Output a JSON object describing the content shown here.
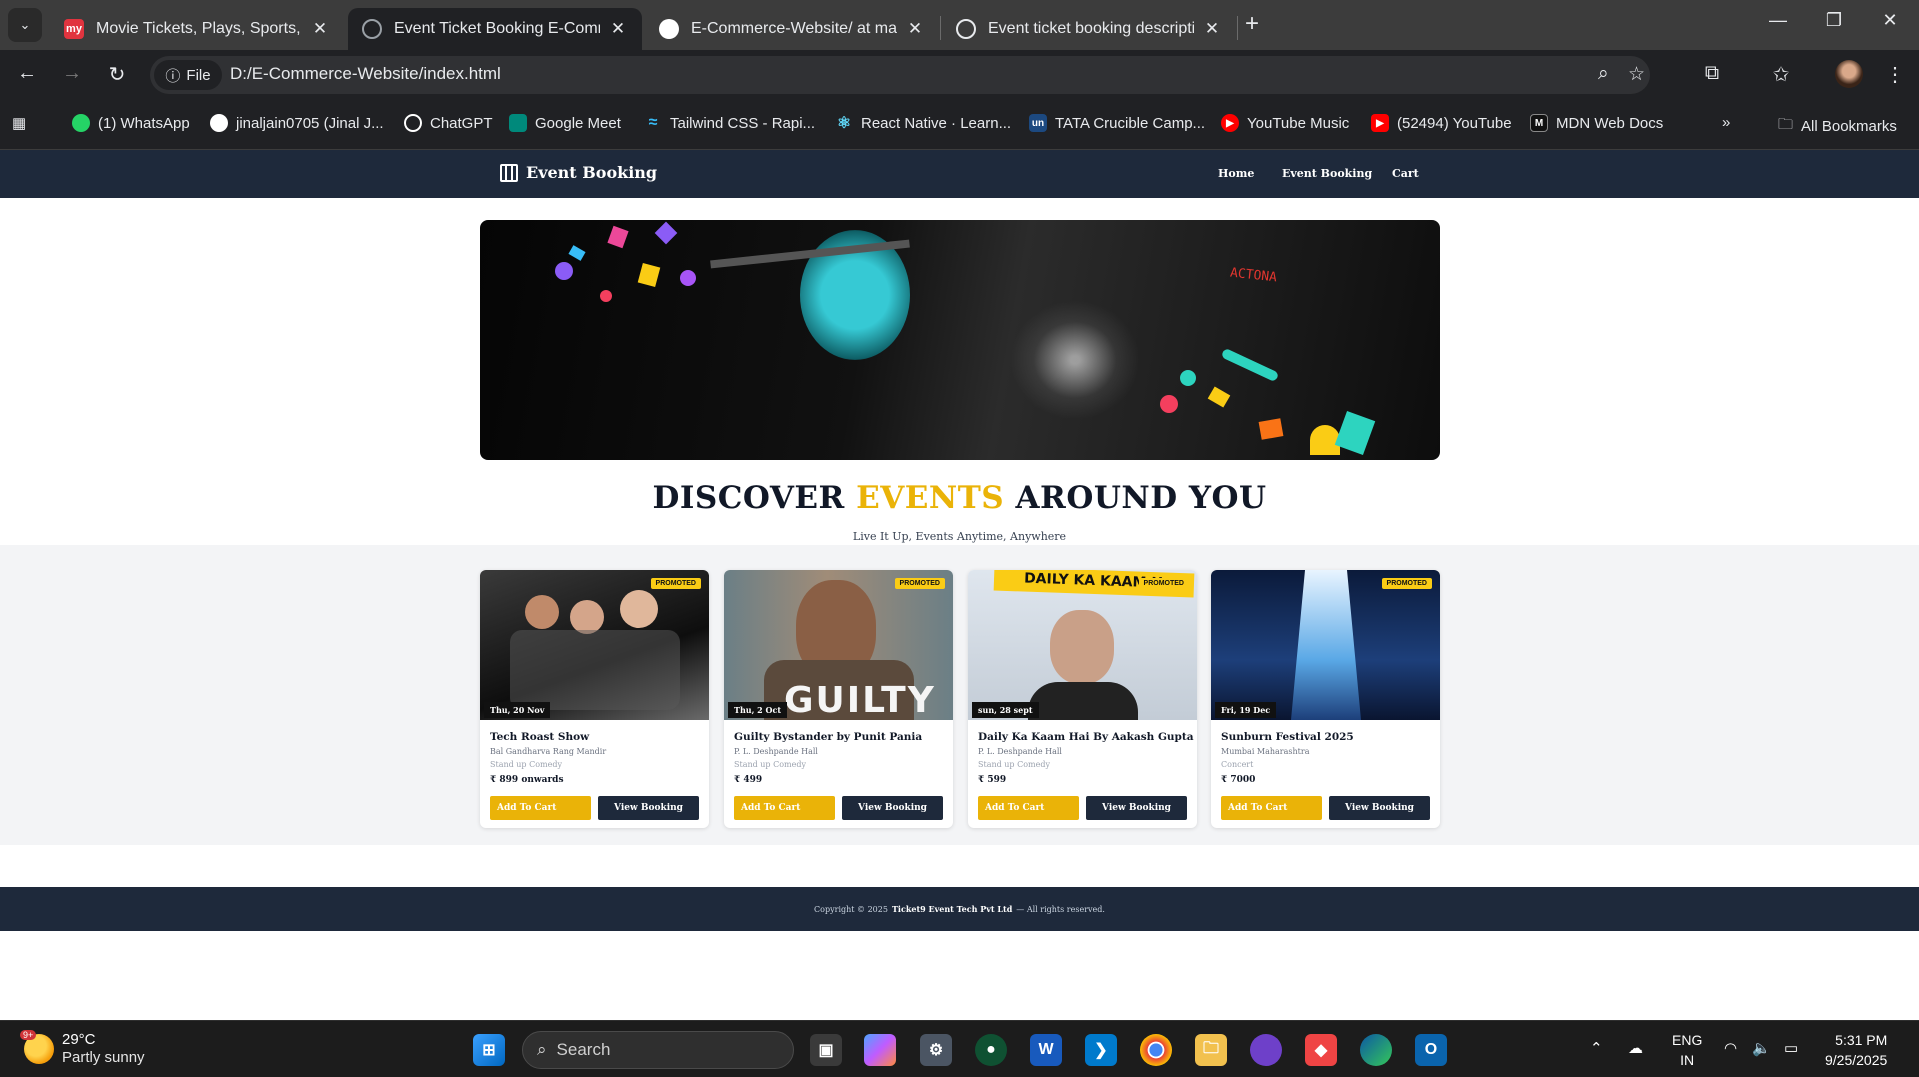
{
  "browser": {
    "tabs": [
      {
        "title": "Movie Tickets, Plays, Sports, Eve",
        "favicon": "my",
        "fav_color": "#e1343f",
        "active": false
      },
      {
        "title": "Event Ticket Booking E-Comme",
        "favicon": "globe",
        "fav_color": "#5f6368",
        "active": true
      },
      {
        "title": "E-Commerce-Website/ at main",
        "favicon": "github",
        "fav_color": "#ffffff",
        "active": false
      },
      {
        "title": "Event ticket booking descriptio",
        "favicon": "openai",
        "fav_color": "#ffffff",
        "active": false
      }
    ],
    "address": {
      "chip": "File",
      "url": "D:/E-Commerce-Website/index.html"
    },
    "bookmarks": [
      {
        "label": "(1) WhatsApp",
        "icon": "whatsapp-icon",
        "color": "#25d366"
      },
      {
        "label": "jinaljain0705 (Jinal J...",
        "icon": "github-icon",
        "color": "#ffffff"
      },
      {
        "label": "ChatGPT",
        "icon": "openai-icon",
        "color": "#ffffff"
      },
      {
        "label": "Google Meet",
        "icon": "meet-icon",
        "color": "#00897b"
      },
      {
        "label": "Tailwind CSS - Rapi...",
        "icon": "tailwind-icon",
        "color": "#38bdf8"
      },
      {
        "label": "React Native · Learn...",
        "icon": "react-icon",
        "color": "#61dafb"
      },
      {
        "label": "TATA Crucible Camp...",
        "icon": "unstop-icon",
        "color": "#1c4980"
      },
      {
        "label": "YouTube Music",
        "icon": "youtube-music-icon",
        "color": "#ff0000"
      },
      {
        "label": "(52494) YouTube",
        "icon": "youtube-icon",
        "color": "#ff0000"
      },
      {
        "label": "MDN Web Docs",
        "icon": "mdn-icon",
        "color": "#111111"
      }
    ],
    "all_bookmarks": "All Bookmarks"
  },
  "site": {
    "brand": "Event Booking",
    "nav": [
      "Home",
      "Event Booking",
      "Cart"
    ],
    "hero_sign": "ACTONA",
    "heading": {
      "part1": "DISCOVER",
      "highlight": "EVENTS",
      "part2": "AROUND  YOU"
    },
    "tagline": "Live It Up, Events Anytime, Anywhere",
    "promo_label": "PROMOTED",
    "cart_label": "Add To Cart",
    "view_label": "View Booking",
    "events": [
      {
        "date": "Thu, 20 Nov",
        "title": "Tech Roast Show",
        "venue": "Bal Gandharva Rang Mandir",
        "genre": "Stand up Comedy",
        "price": "₹ 899  onwards"
      },
      {
        "date": "Thu, 2 Oct",
        "title": "Guilty Bystander by Punit Pania",
        "venue": "P. L. Deshpande Hall",
        "genre": "Stand up Comedy",
        "price": "₹ 499"
      },
      {
        "date": "sun, 28 sept",
        "title": "Daily Ka Kaam Hai By Aakash Gupta",
        "venue": "P. L. Deshpande Hall",
        "genre": "Stand up Comedy",
        "price": "₹ 599"
      },
      {
        "date": "Fri, 19 Dec",
        "title": "Sunburn Festival 2025",
        "venue": "Mumbai Maharashtra",
        "genre": "Concert",
        "price": "₹ 7000"
      }
    ],
    "event_banner_text": [
      "GUILTY",
      "DAILY KA KAAM H"
    ],
    "footer": {
      "prefix": "Copyright © 2025",
      "company": "Ticket9 Event Tech Pvt Ltd",
      "suffix": "— All rights reserved."
    }
  },
  "taskbar": {
    "weather": {
      "temp": "29°C",
      "desc": "Partly sunny",
      "badge": "9+"
    },
    "search_placeholder": "Search",
    "lang": {
      "line1": "ENG",
      "line2": "IN"
    },
    "clock": {
      "time": "5:31 PM",
      "date": "9/25/2025"
    }
  },
  "colors": {
    "nav": "#1e293b",
    "accent": "#eab308",
    "chrome_dark": "#202124"
  }
}
